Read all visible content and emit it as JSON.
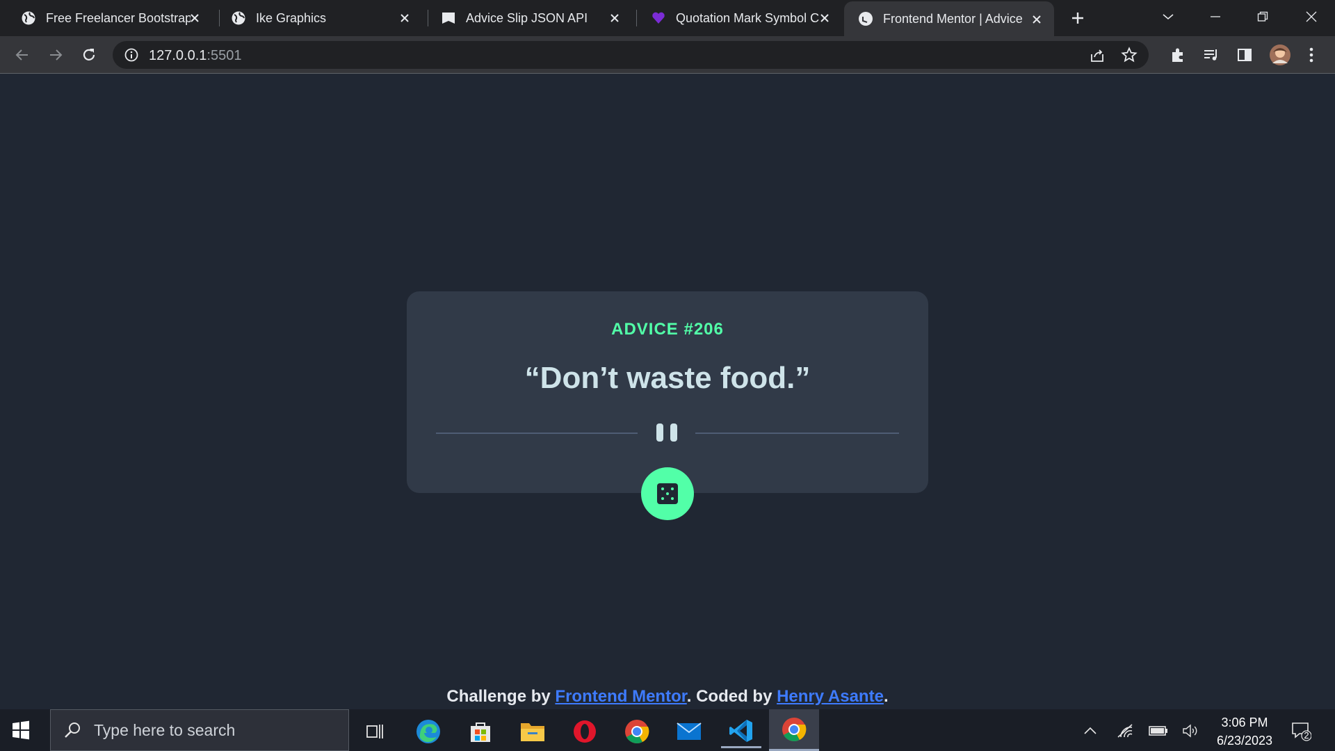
{
  "browser": {
    "tabs": [
      {
        "title": "Free Freelancer Bootstrap",
        "favicon": "globe-icon"
      },
      {
        "title": "Ike Graphics",
        "favicon": "globe-icon"
      },
      {
        "title": "Advice Slip JSON API",
        "favicon": "page-icon"
      },
      {
        "title": "Quotation Mark Symbol C",
        "favicon": "heart-icon"
      },
      {
        "title": "Frontend Mentor | Advice",
        "favicon": "frontend-mentor-icon"
      }
    ],
    "active_tab": 4,
    "url_host": "127.0.0.1",
    "url_port": ":5501"
  },
  "app": {
    "advice_label": "ADVICE #206",
    "advice_text": "“Don’t waste food.”",
    "colors": {
      "background": "#202733",
      "card": "#313a48",
      "accent": "#52ffa8",
      "text": "#cee3e9",
      "link": "#3e7bff"
    }
  },
  "attribution": {
    "prefix": "Challenge by ",
    "link1": "Frontend Mentor",
    "middle": ". Coded by ",
    "link2": "Henry Asante",
    "suffix": "."
  },
  "taskbar": {
    "search_placeholder": "Type here to search",
    "time": "3:06 PM",
    "date": "6/23/2023",
    "notification_count": "2",
    "apps": [
      "task-view",
      "edge",
      "microsoft-store",
      "file-explorer",
      "opera",
      "chrome",
      "mail",
      "vscode",
      "chrome"
    ]
  }
}
